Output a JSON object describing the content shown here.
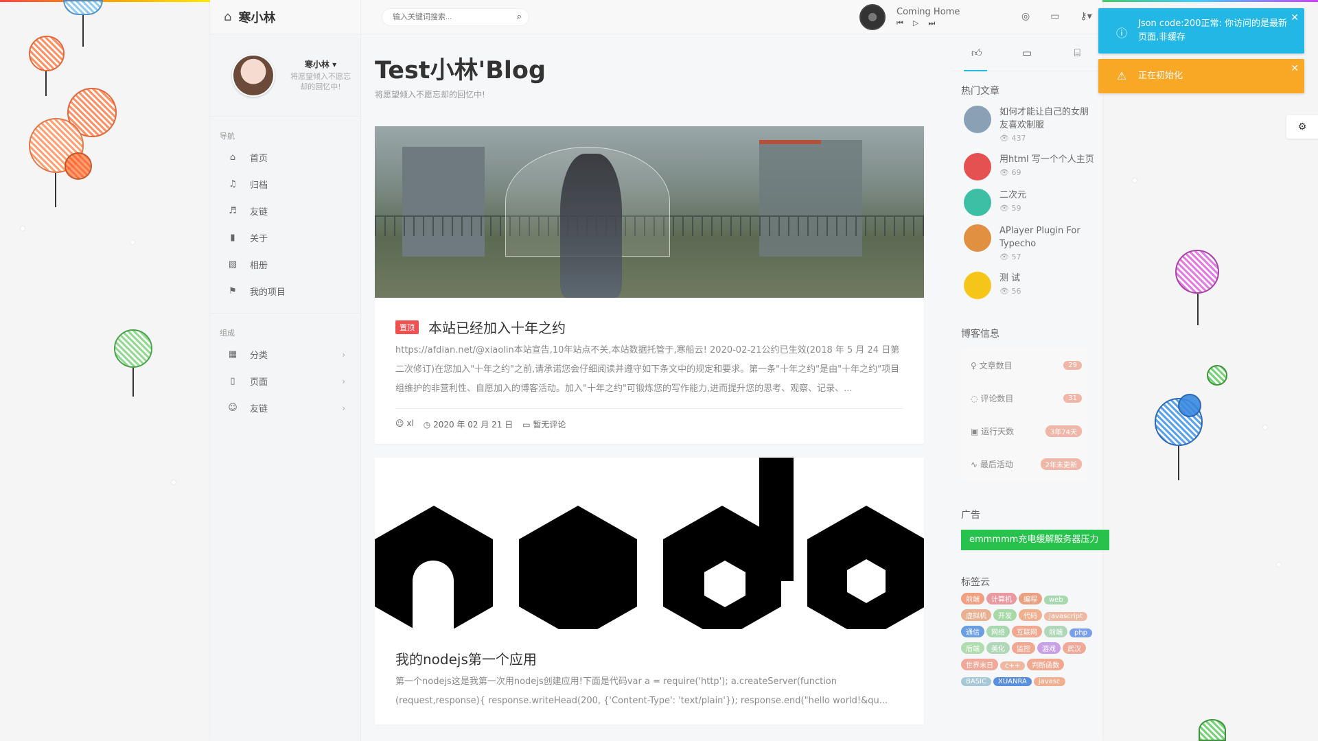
{
  "brand": {
    "title": "寒小林"
  },
  "profile": {
    "name": "寒小林",
    "motto": "将愿望倾入不愿忘却的回忆中!"
  },
  "sidebar": {
    "nav_title": "导航",
    "nav": [
      {
        "label": "首页",
        "icon": "⌂"
      },
      {
        "label": "归档",
        "icon": "♫"
      },
      {
        "label": "友链",
        "icon": "♬"
      },
      {
        "label": "关于",
        "icon": "▮"
      },
      {
        "label": "相册",
        "icon": "▧"
      },
      {
        "label": "我的项目",
        "icon": "⚑"
      }
    ],
    "group_title": "组成",
    "groups": [
      {
        "label": "分类",
        "icon": "▦"
      },
      {
        "label": "页面",
        "icon": "▯"
      },
      {
        "label": "友链",
        "icon": "☺"
      }
    ]
  },
  "header": {
    "search_placeholder": "输入关键词搜索...",
    "song": "Coming Home"
  },
  "page": {
    "title": "Test小林'Blog",
    "subtitle": "将愿望倾入不愿忘却的回忆中!"
  },
  "posts": [
    {
      "badge": "置顶",
      "title": "本站已经加入十年之约",
      "excerpt": "https://afdian.net/@xiaolin本站宣告,10年站点不关,本站数据托管于,寒船云! 2020-02-21公约已生效(2018 年 5 月 24 日第二次修订)在您加入\"十年之约\"之前,请承诺您会仔细阅读并遵守如下条文中的规定和要求。第一条\"十年之约\"是由\"十年之约\"项目组维护的非营利性、自愿加入的博客活动。加入\"十年之约\"可锻炼您的写作能力,进而提升您的思考、观察、记录、...",
      "author": "xl",
      "date": "2020 年 02 月 21 日",
      "comments": "暂无评论"
    },
    {
      "title": "我的nodejs第一个应用",
      "excerpt": "第一个nodejs这是我第一次用nodejs创建应用!下面是代码var a = require('http'); a.createServer(function (request,response){ response.writeHead(200, {'Content-Type': 'text/plain'}); response.end(\"hello world!&qu..."
    }
  ],
  "right": {
    "hot_title": "热门文章",
    "hot": [
      {
        "title": "如何才能让自己的女朋友喜欢制服",
        "views": "437",
        "color": "#8aa0b5"
      },
      {
        "title": "用html 写一个个人主页",
        "views": "69",
        "color": "#e55050"
      },
      {
        "title": "二次元",
        "views": "59",
        "color": "#3dbfa5"
      },
      {
        "title": "APlayer Plugin For Typecho",
        "views": "57",
        "color": "#e09040"
      },
      {
        "title": "测 试",
        "views": "56",
        "color": "#f5c518"
      }
    ],
    "info_title": "博客信息",
    "stats": [
      {
        "label": "文章数目",
        "icon": "♀",
        "value": "29"
      },
      {
        "label": "评论数目",
        "icon": "◌",
        "value": "31"
      },
      {
        "label": "运行天数",
        "icon": "▣",
        "value": "3年74天"
      },
      {
        "label": "最后活动",
        "icon": "∿",
        "value": "2年未更新"
      }
    ],
    "ad_title": "广告",
    "ad_text": "emmmmm充电缓解服务器压力",
    "tags_title": "标签云",
    "tags": [
      {
        "name": "前端",
        "color": "#f0a080"
      },
      {
        "name": "计算机",
        "color": "#e89aa0"
      },
      {
        "name": "编程",
        "color": "#e8a080"
      },
      {
        "name": "web",
        "color": "#a8d8b0"
      },
      {
        "name": "虚拟机",
        "color": "#e8b090"
      },
      {
        "name": "开发",
        "color": "#a8d8a8"
      },
      {
        "name": "代码",
        "color": "#f0b090"
      },
      {
        "name": "Javascript",
        "color": "#f0b8a0"
      },
      {
        "name": "通信",
        "color": "#6a9ee0"
      },
      {
        "name": "网络",
        "color": "#a8d8b0"
      },
      {
        "name": "互联网",
        "color": "#f0a890"
      },
      {
        "name": "前端",
        "color": "#b0d8b8"
      },
      {
        "name": "php",
        "color": "#7a9ee8"
      },
      {
        "name": "后端",
        "color": "#b0dcb0"
      },
      {
        "name": "美化",
        "color": "#b0d8b8"
      },
      {
        "name": "监控",
        "color": "#f0a890"
      },
      {
        "name": "游戏",
        "color": "#c8a0e8"
      },
      {
        "name": "武汉",
        "color": "#f0a898"
      },
      {
        "name": "世界末日",
        "color": "#f0a898"
      },
      {
        "name": "c++",
        "color": "#f0b8a0"
      },
      {
        "name": "判断函数",
        "color": "#f0a890"
      },
      {
        "name": "BASIC",
        "color": "#a8c8d8"
      },
      {
        "name": "XUANRA",
        "color": "#5a8ee0"
      },
      {
        "name": "javasc",
        "color": "#f0b090"
      }
    ]
  },
  "notifications": [
    {
      "text": "Json code:200正常: 你访问的是最新页面,非缓存",
      "color": "#23b7e5",
      "icon": "ⓘ"
    },
    {
      "text": "正在初始化",
      "color": "#fad733",
      "icon": "⚠"
    }
  ],
  "colors": {
    "accent": "#23b7e5",
    "danger": "#f05050",
    "success": "#27c24c",
    "warning": "#f9a825"
  }
}
